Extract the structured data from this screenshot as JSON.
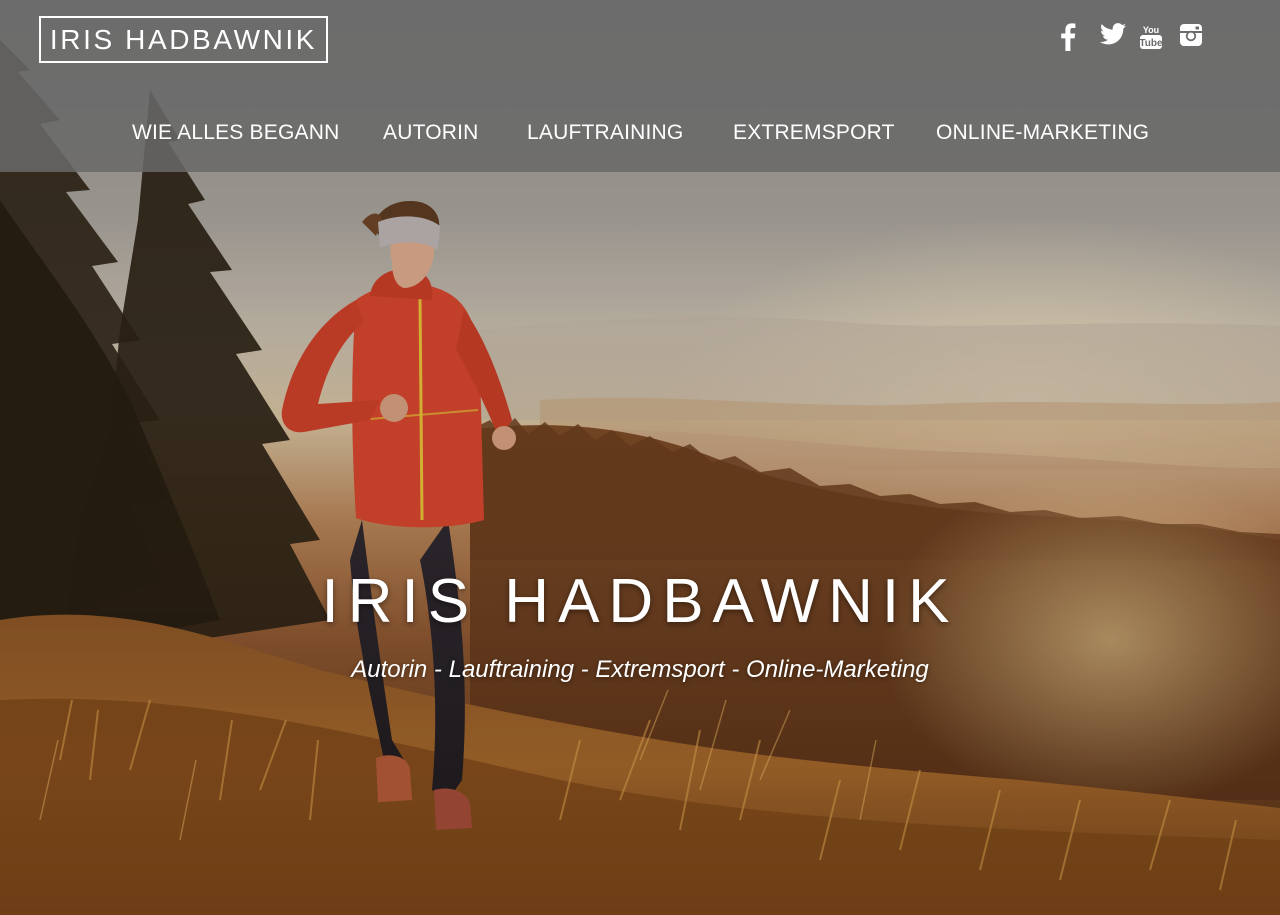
{
  "header": {
    "logo_text": "IRIS HADBAWNIK"
  },
  "social": [
    {
      "name": "facebook-icon"
    },
    {
      "name": "twitter-icon"
    },
    {
      "name": "youtube-icon"
    },
    {
      "name": "instagram-icon"
    }
  ],
  "nav": {
    "items": [
      {
        "label": "WIE ALLES BEGANN"
      },
      {
        "label": "AUTORIN"
      },
      {
        "label": "LAUFTRAINING"
      },
      {
        "label": "EXTREMSPORT"
      },
      {
        "label": "ONLINE-MARKETING"
      }
    ]
  },
  "hero": {
    "title": "IRIS HADBAWNIK",
    "subtitle": "Autorin - Lauftraining - Extremsport - Online-Marketing"
  },
  "colors": {
    "header_bg": "#696969",
    "text": "#ffffff",
    "jacket": "#d8452e",
    "sunset_glow": "#ffecc8"
  }
}
